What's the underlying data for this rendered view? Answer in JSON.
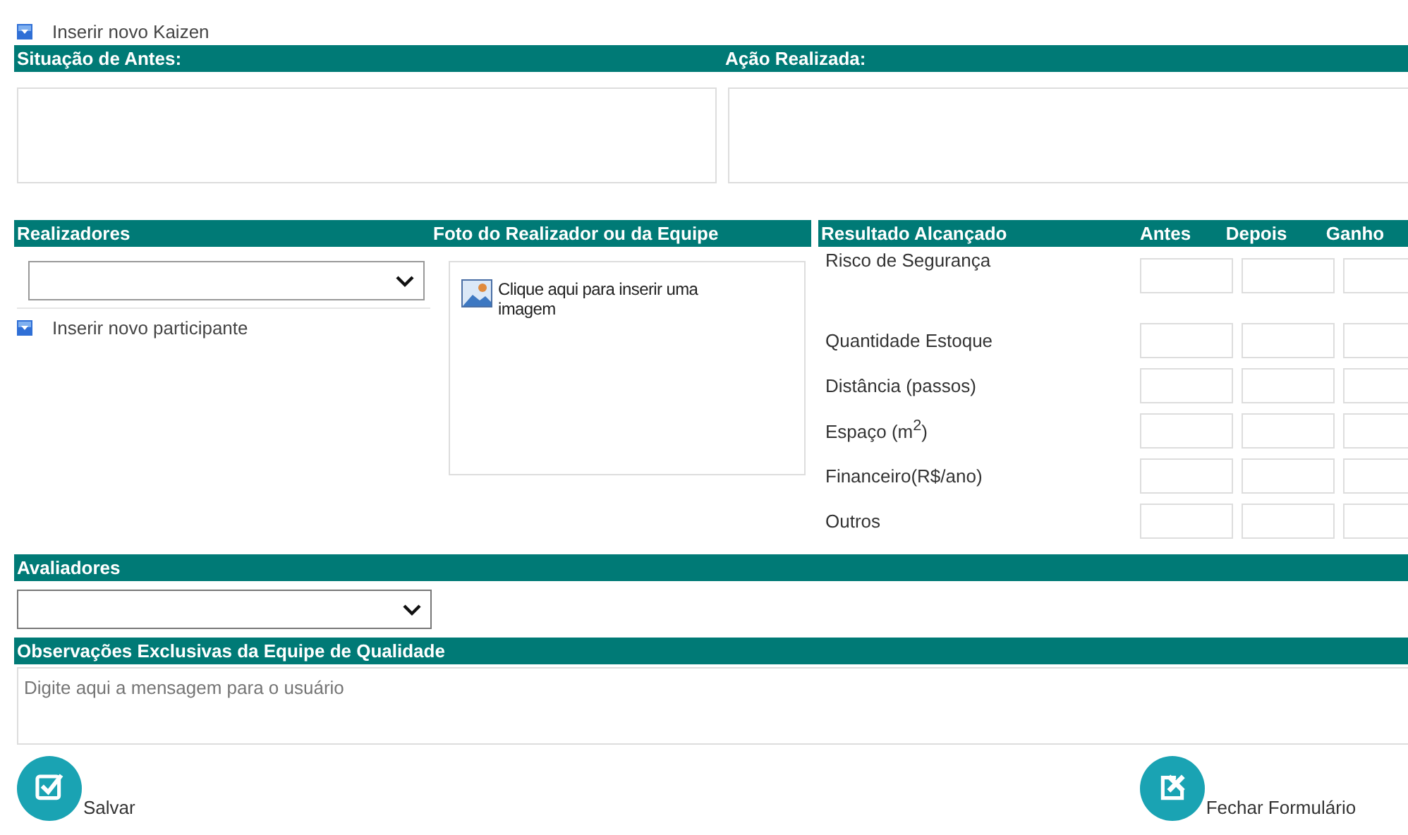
{
  "top_link": {
    "label": "Inserir novo Kaizen"
  },
  "description": {
    "columns": [
      {
        "heading": "Situação de Antes:"
      },
      {
        "heading": "Ação Realizada:"
      }
    ]
  },
  "participants": {
    "heading": "Realizadores",
    "add_link": "Inserir novo participante"
  },
  "photo": {
    "heading": "Foto do Realizador ou da Equipe",
    "prompt": "Clique aqui para inserir uma imagem"
  },
  "results": {
    "columns": [
      "Resultado Alcançado",
      "Antes",
      "Depois",
      "Ganho"
    ],
    "rows": [
      "Risco de Segurança",
      "Quantidade Estoque",
      "Distância (passos)",
      "Espaço (m$^{2}$)",
      "Financeiro(R$/ano)",
      "Outros"
    ]
  },
  "evaluators": {
    "heading": "Avaliadores"
  },
  "notes": {
    "heading": "Observações Exclusivas da Equipe de Qualidade",
    "placeholder": "Digite aqui a mensagem para o usuário"
  },
  "buttons": [
    {
      "kind": "save",
      "label": "Salvar"
    },
    {
      "kind": "close",
      "label": "Fechar Formulário"
    }
  ]
}
